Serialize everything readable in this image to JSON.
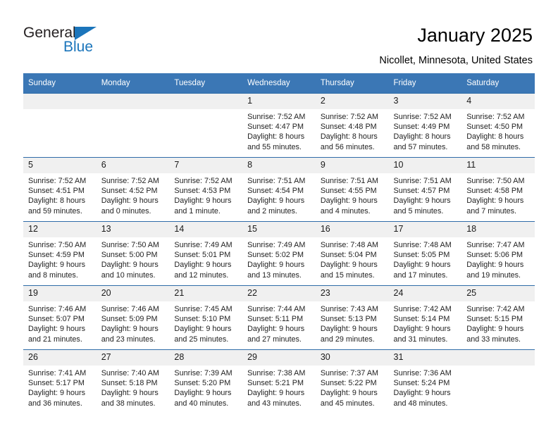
{
  "brand": {
    "word1": "General",
    "word2": "Blue",
    "accent_color": "#1b75bb",
    "logo_icon": "triangle-icon"
  },
  "header": {
    "title": "January 2025",
    "subtitle": "Nicollet, Minnesota, United States"
  },
  "calendar": {
    "header_bg": "#3b77b5",
    "separator_color": "#2f6ca8",
    "daynum_bg": "#f0f0f0",
    "weekdays": [
      "Sunday",
      "Monday",
      "Tuesday",
      "Wednesday",
      "Thursday",
      "Friday",
      "Saturday"
    ],
    "weeks": [
      [
        {
          "day": "",
          "empty": true,
          "sunrise": "",
          "sunset": "",
          "daylight": ""
        },
        {
          "day": "",
          "empty": true,
          "sunrise": "",
          "sunset": "",
          "daylight": ""
        },
        {
          "day": "",
          "empty": true,
          "sunrise": "",
          "sunset": "",
          "daylight": ""
        },
        {
          "day": "1",
          "empty": false,
          "sunrise": "Sunrise: 7:52 AM",
          "sunset": "Sunset: 4:47 PM",
          "daylight": "Daylight: 8 hours and 55 minutes."
        },
        {
          "day": "2",
          "empty": false,
          "sunrise": "Sunrise: 7:52 AM",
          "sunset": "Sunset: 4:48 PM",
          "daylight": "Daylight: 8 hours and 56 minutes."
        },
        {
          "day": "3",
          "empty": false,
          "sunrise": "Sunrise: 7:52 AM",
          "sunset": "Sunset: 4:49 PM",
          "daylight": "Daylight: 8 hours and 57 minutes."
        },
        {
          "day": "4",
          "empty": false,
          "sunrise": "Sunrise: 7:52 AM",
          "sunset": "Sunset: 4:50 PM",
          "daylight": "Daylight: 8 hours and 58 minutes."
        }
      ],
      [
        {
          "day": "5",
          "empty": false,
          "sunrise": "Sunrise: 7:52 AM",
          "sunset": "Sunset: 4:51 PM",
          "daylight": "Daylight: 8 hours and 59 minutes."
        },
        {
          "day": "6",
          "empty": false,
          "sunrise": "Sunrise: 7:52 AM",
          "sunset": "Sunset: 4:52 PM",
          "daylight": "Daylight: 9 hours and 0 minutes."
        },
        {
          "day": "7",
          "empty": false,
          "sunrise": "Sunrise: 7:52 AM",
          "sunset": "Sunset: 4:53 PM",
          "daylight": "Daylight: 9 hours and 1 minute."
        },
        {
          "day": "8",
          "empty": false,
          "sunrise": "Sunrise: 7:51 AM",
          "sunset": "Sunset: 4:54 PM",
          "daylight": "Daylight: 9 hours and 2 minutes."
        },
        {
          "day": "9",
          "empty": false,
          "sunrise": "Sunrise: 7:51 AM",
          "sunset": "Sunset: 4:55 PM",
          "daylight": "Daylight: 9 hours and 4 minutes."
        },
        {
          "day": "10",
          "empty": false,
          "sunrise": "Sunrise: 7:51 AM",
          "sunset": "Sunset: 4:57 PM",
          "daylight": "Daylight: 9 hours and 5 minutes."
        },
        {
          "day": "11",
          "empty": false,
          "sunrise": "Sunrise: 7:50 AM",
          "sunset": "Sunset: 4:58 PM",
          "daylight": "Daylight: 9 hours and 7 minutes."
        }
      ],
      [
        {
          "day": "12",
          "empty": false,
          "sunrise": "Sunrise: 7:50 AM",
          "sunset": "Sunset: 4:59 PM",
          "daylight": "Daylight: 9 hours and 8 minutes."
        },
        {
          "day": "13",
          "empty": false,
          "sunrise": "Sunrise: 7:50 AM",
          "sunset": "Sunset: 5:00 PM",
          "daylight": "Daylight: 9 hours and 10 minutes."
        },
        {
          "day": "14",
          "empty": false,
          "sunrise": "Sunrise: 7:49 AM",
          "sunset": "Sunset: 5:01 PM",
          "daylight": "Daylight: 9 hours and 12 minutes."
        },
        {
          "day": "15",
          "empty": false,
          "sunrise": "Sunrise: 7:49 AM",
          "sunset": "Sunset: 5:02 PM",
          "daylight": "Daylight: 9 hours and 13 minutes."
        },
        {
          "day": "16",
          "empty": false,
          "sunrise": "Sunrise: 7:48 AM",
          "sunset": "Sunset: 5:04 PM",
          "daylight": "Daylight: 9 hours and 15 minutes."
        },
        {
          "day": "17",
          "empty": false,
          "sunrise": "Sunrise: 7:48 AM",
          "sunset": "Sunset: 5:05 PM",
          "daylight": "Daylight: 9 hours and 17 minutes."
        },
        {
          "day": "18",
          "empty": false,
          "sunrise": "Sunrise: 7:47 AM",
          "sunset": "Sunset: 5:06 PM",
          "daylight": "Daylight: 9 hours and 19 minutes."
        }
      ],
      [
        {
          "day": "19",
          "empty": false,
          "sunrise": "Sunrise: 7:46 AM",
          "sunset": "Sunset: 5:07 PM",
          "daylight": "Daylight: 9 hours and 21 minutes."
        },
        {
          "day": "20",
          "empty": false,
          "sunrise": "Sunrise: 7:46 AM",
          "sunset": "Sunset: 5:09 PM",
          "daylight": "Daylight: 9 hours and 23 minutes."
        },
        {
          "day": "21",
          "empty": false,
          "sunrise": "Sunrise: 7:45 AM",
          "sunset": "Sunset: 5:10 PM",
          "daylight": "Daylight: 9 hours and 25 minutes."
        },
        {
          "day": "22",
          "empty": false,
          "sunrise": "Sunrise: 7:44 AM",
          "sunset": "Sunset: 5:11 PM",
          "daylight": "Daylight: 9 hours and 27 minutes."
        },
        {
          "day": "23",
          "empty": false,
          "sunrise": "Sunrise: 7:43 AM",
          "sunset": "Sunset: 5:13 PM",
          "daylight": "Daylight: 9 hours and 29 minutes."
        },
        {
          "day": "24",
          "empty": false,
          "sunrise": "Sunrise: 7:42 AM",
          "sunset": "Sunset: 5:14 PM",
          "daylight": "Daylight: 9 hours and 31 minutes."
        },
        {
          "day": "25",
          "empty": false,
          "sunrise": "Sunrise: 7:42 AM",
          "sunset": "Sunset: 5:15 PM",
          "daylight": "Daylight: 9 hours and 33 minutes."
        }
      ],
      [
        {
          "day": "26",
          "empty": false,
          "sunrise": "Sunrise: 7:41 AM",
          "sunset": "Sunset: 5:17 PM",
          "daylight": "Daylight: 9 hours and 36 minutes."
        },
        {
          "day": "27",
          "empty": false,
          "sunrise": "Sunrise: 7:40 AM",
          "sunset": "Sunset: 5:18 PM",
          "daylight": "Daylight: 9 hours and 38 minutes."
        },
        {
          "day": "28",
          "empty": false,
          "sunrise": "Sunrise: 7:39 AM",
          "sunset": "Sunset: 5:20 PM",
          "daylight": "Daylight: 9 hours and 40 minutes."
        },
        {
          "day": "29",
          "empty": false,
          "sunrise": "Sunrise: 7:38 AM",
          "sunset": "Sunset: 5:21 PM",
          "daylight": "Daylight: 9 hours and 43 minutes."
        },
        {
          "day": "30",
          "empty": false,
          "sunrise": "Sunrise: 7:37 AM",
          "sunset": "Sunset: 5:22 PM",
          "daylight": "Daylight: 9 hours and 45 minutes."
        },
        {
          "day": "31",
          "empty": false,
          "sunrise": "Sunrise: 7:36 AM",
          "sunset": "Sunset: 5:24 PM",
          "daylight": "Daylight: 9 hours and 48 minutes."
        },
        {
          "day": "",
          "empty": true,
          "sunrise": "",
          "sunset": "",
          "daylight": ""
        }
      ]
    ]
  }
}
